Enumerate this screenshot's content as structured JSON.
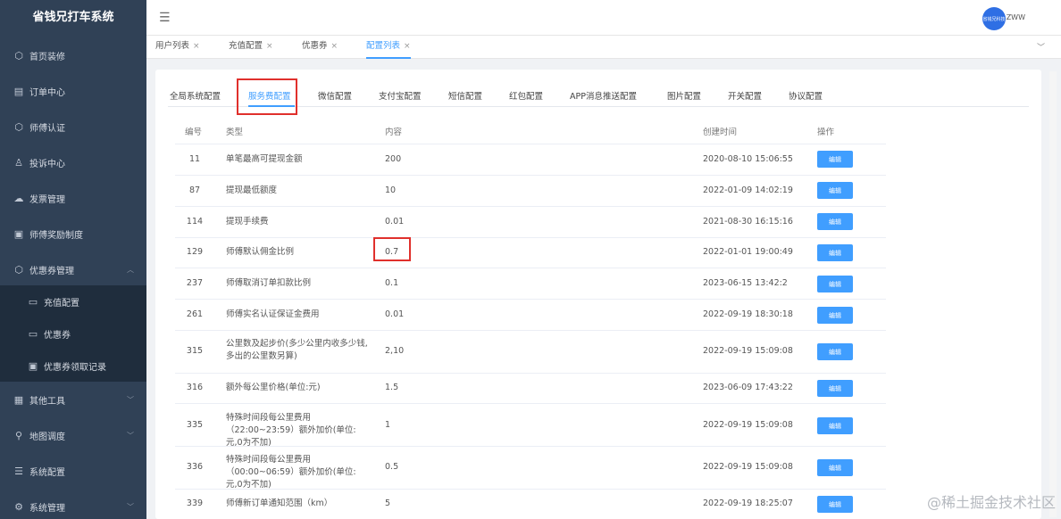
{
  "app": {
    "title": "省钱兄打车系统"
  },
  "sidebar": {
    "items": [
      {
        "label": "首页装修",
        "icon": "cube-icon"
      },
      {
        "label": "订单中心",
        "icon": "document-icon"
      },
      {
        "label": "师傅认证",
        "icon": "cube-icon"
      },
      {
        "label": "投诉中心",
        "icon": "user-icon"
      },
      {
        "label": "发票管理",
        "icon": "cloud-icon"
      },
      {
        "label": "师傅奖励制度",
        "icon": "id-card-icon"
      },
      {
        "label": "优惠券管理",
        "icon": "cube-icon",
        "expanded": true,
        "children": [
          {
            "label": "充值配置",
            "icon": "card-icon"
          },
          {
            "label": "优惠券",
            "icon": "card-icon"
          },
          {
            "label": "优惠券领取记录",
            "icon": "id-card-icon"
          }
        ]
      },
      {
        "label": "其他工具",
        "icon": "calendar-icon"
      },
      {
        "label": "地图调度",
        "icon": "location-icon"
      },
      {
        "label": "系统配置",
        "icon": "list-icon"
      },
      {
        "label": "系统管理",
        "icon": "gear-icon"
      }
    ]
  },
  "header": {
    "avatar_text": "省钱兄科技",
    "username": "ZWW"
  },
  "page_tabs": [
    {
      "label": "用户列表",
      "active": false
    },
    {
      "label": "充值配置",
      "active": false
    },
    {
      "label": "优惠券",
      "active": false
    },
    {
      "label": "配置列表",
      "active": true
    }
  ],
  "config_tabs": [
    {
      "label": "全局系统配置",
      "active": false
    },
    {
      "label": "服务费配置",
      "active": true
    },
    {
      "label": "微信配置",
      "active": false
    },
    {
      "label": "支付宝配置",
      "active": false
    },
    {
      "label": "短信配置",
      "active": false
    },
    {
      "label": "红包配置",
      "active": false
    },
    {
      "label": "APP消息推送配置",
      "active": false
    },
    {
      "label": "图片配置",
      "active": false
    },
    {
      "label": "开关配置",
      "active": false
    },
    {
      "label": "协议配置",
      "active": false
    }
  ],
  "table": {
    "headers": [
      "编号",
      "类型",
      "内容",
      "创建时间",
      "操作"
    ],
    "edit_label": "编辑",
    "rows": [
      {
        "id": "11",
        "type": "单笔最高可提现金额",
        "value": "200",
        "time": "2020-08-10 15:06:55"
      },
      {
        "id": "87",
        "type": "提现最低额度",
        "value": "10",
        "time": "2022-01-09 14:02:19"
      },
      {
        "id": "114",
        "type": "提现手续费",
        "value": "0.01",
        "time": "2021-08-30 16:15:16"
      },
      {
        "id": "129",
        "type": "师傅默认佣金比例",
        "value": "0.7",
        "time": "2022-01-01 19:00:49",
        "highlight": true
      },
      {
        "id": "237",
        "type": "师傅取消订单扣款比例",
        "value": "0.1",
        "time": "2023-06-15 13:42:2"
      },
      {
        "id": "261",
        "type": "师傅实名认证保证金费用",
        "value": "0.01",
        "time": "2022-09-19 18:30:18"
      },
      {
        "id": "315",
        "type": "公里数及起步价(多少公里内收多少钱,多出的公里数另算)",
        "value": "2,10",
        "time": "2022-09-19 15:09:08"
      },
      {
        "id": "316",
        "type": "额外每公里价格(单位:元)",
        "value": "1.5",
        "time": "2023-06-09 17:43:22"
      },
      {
        "id": "335",
        "type": "特殊时间段每公里费用（22:00~23:59）额外加价(单位:元,0为不加)",
        "value": "1",
        "time": "2022-09-19 15:09:08"
      },
      {
        "id": "336",
        "type": "特殊时间段每公里费用（00:00~06:59）额外加价(单位:元,0为不加)",
        "value": "0.5",
        "time": "2022-09-19 15:09:08"
      },
      {
        "id": "339",
        "type": "师傅新订单通知范围（km）",
        "value": "5",
        "time": "2022-09-19 18:25:07"
      }
    ]
  },
  "watermark": "@稀土掘金技术社区",
  "colors": {
    "sidebar": "#304156",
    "accent": "#409eff",
    "highlight": "#e0302c"
  }
}
